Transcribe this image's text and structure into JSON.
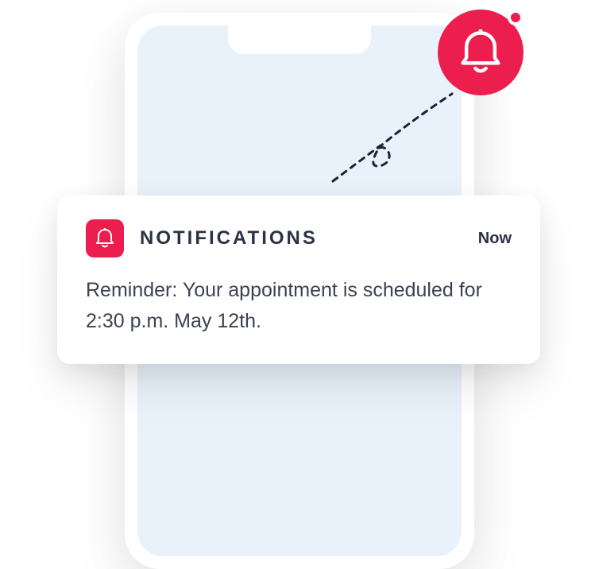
{
  "colors": {
    "accent": "#eb1e4e",
    "screen_bg": "#e9f1fb",
    "text_dark": "#2a3244",
    "text_body": "#3a4254"
  },
  "notification": {
    "title": "NOTIFICATIONS",
    "time": "Now",
    "message": "Reminder: Your  appointment is scheduled for 2:30 p.m. May 12th."
  },
  "icons": {
    "bell_badge": "bell-icon",
    "card_icon": "bell-icon"
  }
}
